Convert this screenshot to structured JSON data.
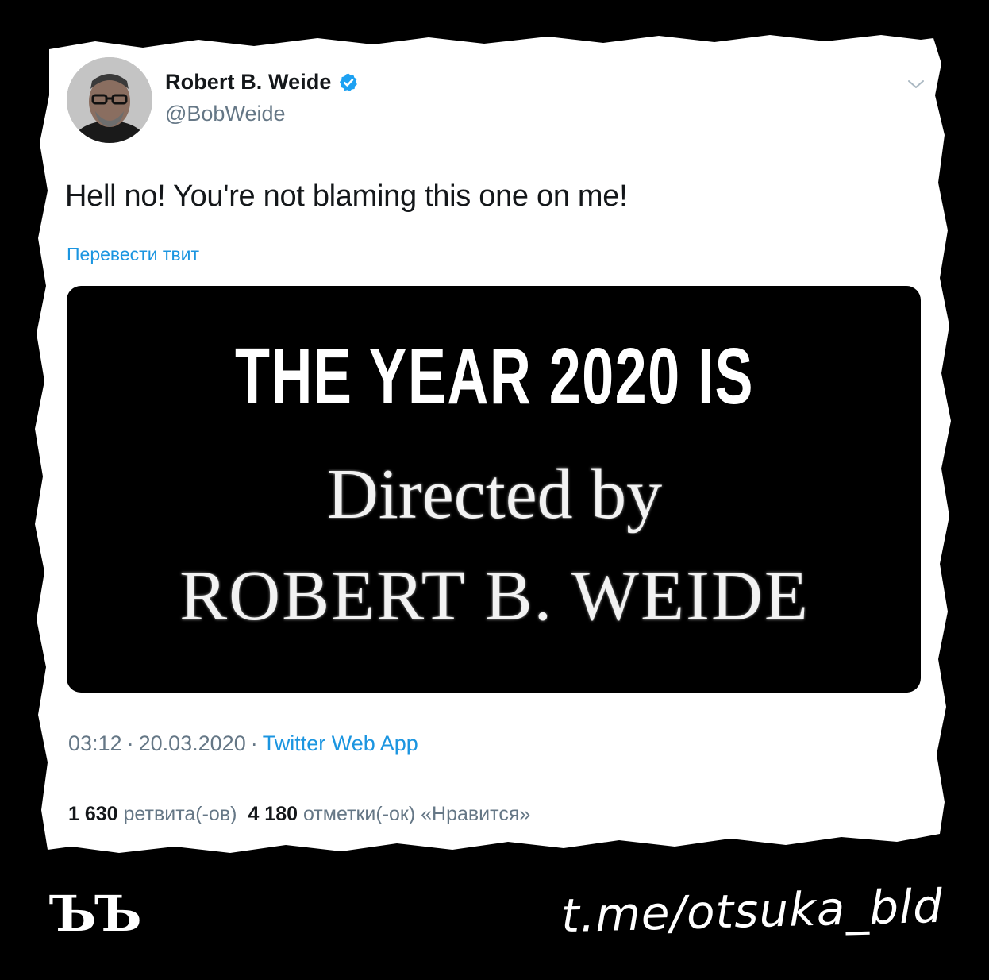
{
  "tweet": {
    "display_name": "Robert B. Weide",
    "handle": "@BobWeide",
    "text": "Hell no! You're not blaming this one on me!",
    "translate_label": "Перевести твит",
    "media": {
      "line1": "THE YEAR 2020 IS",
      "line2": "Directed by",
      "line3": "ROBERT B. WEIDE"
    },
    "time": "03:12",
    "date": "20.03.2020",
    "separator": "·",
    "source": "Twitter Web App",
    "stats": {
      "retweets_count": "1 630",
      "retweets_label": "ретвита(-ов)",
      "likes_count": "4 180",
      "likes_label": "отметки(-ок) «Нравится»"
    },
    "icons": {
      "verified": "verified-badge-icon",
      "menu": "chevron-down-icon"
    },
    "colors": {
      "link": "#1b95e0",
      "text": "#14171a",
      "secondary": "#657786"
    }
  },
  "watermark": {
    "logo": "ЪЪ",
    "channel": "t.me/otsuka_bld"
  }
}
